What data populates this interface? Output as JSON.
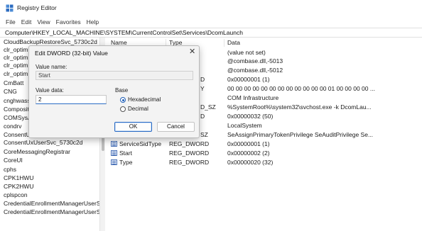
{
  "window": {
    "title": "Registry Editor"
  },
  "menu": [
    "File",
    "Edit",
    "View",
    "Favorites",
    "Help"
  ],
  "address": "Computer\\HKEY_LOCAL_MACHINE\\SYSTEM\\CurrentControlSet\\Services\\DcomLaunch",
  "tree": [
    "CloudBackupRestoreSvc_5730c2d",
    "clr_optimiz",
    "clr_optimiz",
    "clr_optimiz",
    "clr_optimiz",
    "CmBatt",
    "CNG",
    "cnghwassi",
    "Composite",
    "COMSysAp",
    "condrv",
    "ConsentUx",
    "ConsentUxUserSvc_5730c2d",
    "CoreMessagingRegistrar",
    "CoreUI",
    "cphs",
    "CPK1HWU",
    "CPK2HWU",
    "cplspcon",
    "CredentialEnrollmentManagerUserSv",
    "CredentialEnrollmentManagerUserSv"
  ],
  "columns": {
    "name": "Name",
    "type": "Type",
    "data": "Data"
  },
  "values": [
    {
      "name": "",
      "type": "",
      "data": "(value not set)"
    },
    {
      "name": "",
      "type": "",
      "data": "@combase.dll,-5013"
    },
    {
      "name": "",
      "type": "",
      "data": "@combase.dll,-5012"
    },
    {
      "name": "",
      "type": "D",
      "data": "0x00000001 (1)"
    },
    {
      "name": "",
      "type": "Y",
      "data": "00 00 00 00 00 00 00 00 00 00 00 00 01 00 00 00 00 ..."
    },
    {
      "name": "",
      "type": "",
      "data": "COM Infrastructure"
    },
    {
      "name": "",
      "type": "D_SZ",
      "data": "%SystemRoot%\\system32\\svchost.exe -k DcomLau..."
    },
    {
      "name": "",
      "type": "D",
      "data": "0x00000032 (50)"
    },
    {
      "name": "",
      "type": "",
      "data": "LocalSystem"
    },
    {
      "name": "",
      "type": "SZ",
      "data": "SeAssignPrimaryTokenPrivilege SeAuditPrivilege Se..."
    },
    {
      "name": "ServiceSidType",
      "type": "REG_DWORD",
      "data": "0x00000001 (1)"
    },
    {
      "name": "Start",
      "type": "REG_DWORD",
      "data": "0x00000002 (2)"
    },
    {
      "name": "Type",
      "type": "REG_DWORD",
      "data": "0x00000020 (32)"
    }
  ],
  "dialog": {
    "title": "Edit DWORD (32-bit) Value",
    "close_glyph": "✕",
    "value_name_label": "Value name:",
    "value_name": "Start",
    "value_data_label": "Value data:",
    "value_data": "2",
    "base_label": "Base",
    "hex_label": "Hexadecimal",
    "dec_label": "Decimal",
    "selected_base": "Hexadecimal",
    "ok_label": "OK",
    "cancel_label": "Cancel"
  },
  "colors": {
    "accent": "#2a6bc4",
    "icon": "#4a72b8"
  }
}
